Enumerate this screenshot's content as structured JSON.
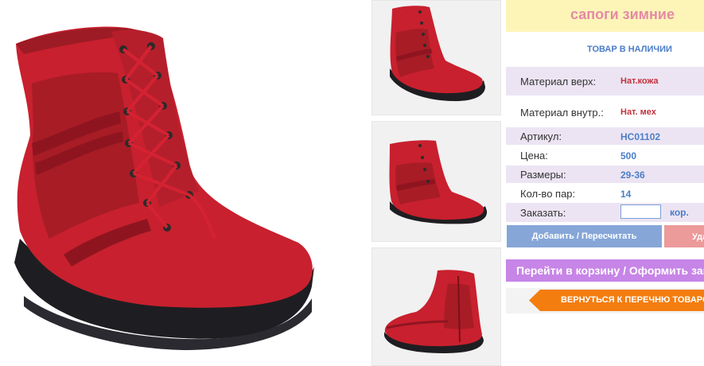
{
  "product": {
    "title": "сапоги зимние",
    "stock_status": "ТОВАР В НАЛИЧИИ"
  },
  "specs": {
    "material_upper_label": "Материал верх:",
    "material_upper_value": "Нат.кожа",
    "material_inner_label": "Материал внутр.:",
    "material_inner_value": "Нат. мех",
    "article_label": "Артикул:",
    "article_value": "НС01102",
    "price_label": "Цена:",
    "price_value": "500",
    "sizes_label": "Размеры:",
    "sizes_value": "29-36",
    "pairs_label": "Кол-во пар:",
    "pairs_value": "14",
    "order_label": "Заказать:",
    "order_unit": "кор."
  },
  "order_input": {
    "value": ""
  },
  "actions": {
    "add_recalc": "Добавить / Пересчитать",
    "delete": "Удалить",
    "go_to_cart": "Перейти в корзину / Оформить заказ",
    "back_to_list": "ВЕРНУТЬСЯ К ПЕРЕЧНЮ ТОВАРОВ"
  },
  "colors": {
    "boot_red": "#c8202e",
    "title_bg": "#fdf5b8",
    "title_text": "#e58aa5",
    "accent_blue": "#4b7ec7",
    "cart_purple": "#c785e7",
    "back_orange": "#f47d0f"
  }
}
